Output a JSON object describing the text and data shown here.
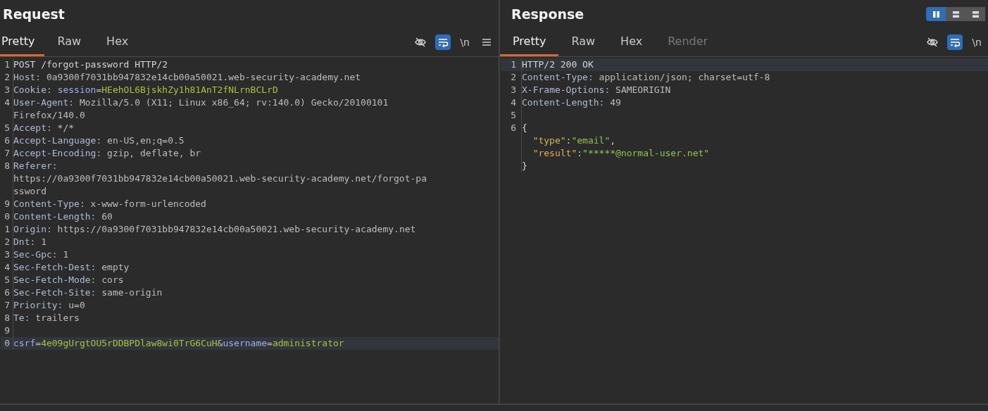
{
  "request": {
    "title": "Request",
    "tabs": [
      {
        "label": "Pretty",
        "selected": true,
        "disabled": false
      },
      {
        "label": "Raw",
        "selected": false,
        "disabled": false
      },
      {
        "label": "Hex",
        "selected": false,
        "disabled": false
      }
    ],
    "toolbar": {
      "hide_on": false,
      "wrap_on": true,
      "newline_label": "\\n",
      "menu": true
    },
    "lines": [
      {
        "number": "1",
        "highlighted": false,
        "tokens": [
          {
            "kind": "plain",
            "text": "POST /forgot-password HTTP/2"
          }
        ]
      },
      {
        "number": "2",
        "highlighted": false,
        "tokens": [
          {
            "kind": "name",
            "text": "Host:"
          },
          {
            "kind": "value",
            "text": " 0a9300f7031bb947832e14cb00a50021.web-security-academy.net"
          }
        ]
      },
      {
        "number": "3",
        "highlighted": false,
        "tokens": [
          {
            "kind": "name",
            "text": "Cookie: "
          },
          {
            "kind": "param",
            "text": "session"
          },
          {
            "kind": "value",
            "text": "="
          },
          {
            "kind": "paramvalue",
            "text": "HEehOL6BjskhZy1h81AnT2fNLrnBCLrD"
          }
        ]
      },
      {
        "number": "4",
        "highlighted": false,
        "tokens": [
          {
            "kind": "name",
            "text": "User-Agent:"
          },
          {
            "kind": "value",
            "text": " Mozilla/5.0 (X11; Linux x86_64; rv:140.0) Gecko/20100101"
          }
        ]
      },
      {
        "highlighted": false,
        "tokens": [
          {
            "kind": "value",
            "text": "Firefox/140.0"
          }
        ]
      },
      {
        "number": "5",
        "highlighted": false,
        "tokens": [
          {
            "kind": "name",
            "text": "Accept:"
          },
          {
            "kind": "value",
            "text": " */*"
          }
        ]
      },
      {
        "number": "6",
        "highlighted": false,
        "tokens": [
          {
            "kind": "name",
            "text": "Accept-Language:"
          },
          {
            "kind": "value",
            "text": " en-US,en;q=0.5"
          }
        ]
      },
      {
        "number": "7",
        "highlighted": false,
        "tokens": [
          {
            "kind": "name",
            "text": "Accept-Encoding:"
          },
          {
            "kind": "value",
            "text": " gzip, deflate, br"
          }
        ]
      },
      {
        "number": "8",
        "highlighted": false,
        "tokens": [
          {
            "kind": "name",
            "text": "Referer:"
          }
        ]
      },
      {
        "highlighted": false,
        "tokens": [
          {
            "kind": "value",
            "text": "https://0a9300f7031bb947832e14cb00a50021.web-security-academy.net/forgot-pa"
          }
        ]
      },
      {
        "highlighted": false,
        "tokens": [
          {
            "kind": "value",
            "text": "ssword"
          }
        ]
      },
      {
        "number": "9",
        "highlighted": false,
        "tokens": [
          {
            "kind": "name",
            "text": "Content-Type:"
          },
          {
            "kind": "value",
            "text": " x-www-form-urlencoded"
          }
        ]
      },
      {
        "number": "0",
        "highlighted": false,
        "tokens": [
          {
            "kind": "name",
            "text": "Content-Length:"
          },
          {
            "kind": "value",
            "text": " 60"
          }
        ]
      },
      {
        "number": "1",
        "highlighted": false,
        "tokens": [
          {
            "kind": "name",
            "text": "Origin:"
          },
          {
            "kind": "value",
            "text": " https://0a9300f7031bb947832e14cb00a50021.web-security-academy.net"
          }
        ]
      },
      {
        "number": "2",
        "highlighted": false,
        "tokens": [
          {
            "kind": "name",
            "text": "Dnt:"
          },
          {
            "kind": "value",
            "text": " 1"
          }
        ]
      },
      {
        "number": "3",
        "highlighted": false,
        "tokens": [
          {
            "kind": "name",
            "text": "Sec-Gpc:"
          },
          {
            "kind": "value",
            "text": " 1"
          }
        ]
      },
      {
        "number": "4",
        "highlighted": false,
        "tokens": [
          {
            "kind": "name",
            "text": "Sec-Fetch-Dest:"
          },
          {
            "kind": "value",
            "text": " empty"
          }
        ]
      },
      {
        "number": "5",
        "highlighted": false,
        "tokens": [
          {
            "kind": "name",
            "text": "Sec-Fetch-Mode:"
          },
          {
            "kind": "value",
            "text": " cors"
          }
        ]
      },
      {
        "number": "6",
        "highlighted": false,
        "tokens": [
          {
            "kind": "name",
            "text": "Sec-Fetch-Site:"
          },
          {
            "kind": "value",
            "text": " same-origin"
          }
        ]
      },
      {
        "number": "7",
        "highlighted": false,
        "tokens": [
          {
            "kind": "name",
            "text": "Priority:"
          },
          {
            "kind": "value",
            "text": " u=0"
          }
        ]
      },
      {
        "number": "8",
        "highlighted": false,
        "tokens": [
          {
            "kind": "name",
            "text": "Te:"
          },
          {
            "kind": "value",
            "text": " trailers"
          }
        ]
      },
      {
        "number": "9",
        "highlighted": false
      },
      {
        "number": "0",
        "highlighted": true,
        "tokens": [
          {
            "kind": "param",
            "text": "csrf"
          },
          {
            "kind": "value",
            "text": "="
          },
          {
            "kind": "paramvalue",
            "text": "4e09gUrgtOU5rDDBPDlaw8wi0TrG6CuH"
          },
          {
            "kind": "value",
            "text": "&"
          },
          {
            "kind": "param",
            "text": "username"
          },
          {
            "kind": "value",
            "text": "="
          },
          {
            "kind": "paramvalue",
            "text": "administrator"
          }
        ]
      }
    ]
  },
  "response": {
    "title": "Response",
    "layout_toggle": [
      {
        "selected": true
      },
      {
        "selected": false
      },
      {
        "selected": false
      }
    ],
    "tabs": [
      {
        "label": "Pretty",
        "selected": true,
        "disabled": false
      },
      {
        "label": "Raw",
        "selected": false,
        "disabled": false
      },
      {
        "label": "Hex",
        "selected": false,
        "disabled": false
      },
      {
        "label": "Render",
        "selected": false,
        "disabled": true
      }
    ],
    "toolbar": {
      "hide_on": false,
      "wrap_on": true,
      "newline_label": "\\n"
    },
    "lines": [
      {
        "number": "1",
        "highlighted": true,
        "tokens": [
          {
            "kind": "plain",
            "text": "HTTP/2 200 OK"
          }
        ]
      },
      {
        "number": "2",
        "highlighted": false,
        "tokens": [
          {
            "kind": "name",
            "text": "Content-Type:"
          },
          {
            "kind": "value",
            "text": " application/json; charset=utf-8"
          }
        ]
      },
      {
        "number": "3",
        "highlighted": false,
        "tokens": [
          {
            "kind": "name",
            "text": "X-Frame-Options:"
          },
          {
            "kind": "value",
            "text": " SAMEORIGIN"
          }
        ]
      },
      {
        "number": "4",
        "highlighted": false,
        "tokens": [
          {
            "kind": "name",
            "text": "Content-Length:"
          },
          {
            "kind": "value",
            "text": " 49"
          }
        ]
      },
      {
        "number": "5",
        "highlighted": false
      },
      {
        "number": "6",
        "highlighted": false,
        "tokens": [
          {
            "kind": "plain",
            "text": "{"
          }
        ]
      },
      {
        "indented": true,
        "highlighted": false,
        "tokens": [
          {
            "kind": "key",
            "text": "\"type\""
          },
          {
            "kind": "plain",
            "text": ":"
          },
          {
            "kind": "string",
            "text": "\"email\""
          },
          {
            "kind": "plain",
            "text": ","
          }
        ]
      },
      {
        "indented": true,
        "highlighted": false,
        "tokens": [
          {
            "kind": "key",
            "text": "\"result\""
          },
          {
            "kind": "plain",
            "text": ":"
          },
          {
            "kind": "string",
            "text": "\"*****@normal-user.net\""
          }
        ]
      },
      {
        "highlighted": false,
        "tokens": [
          {
            "kind": "plain",
            "text": "}"
          }
        ]
      }
    ]
  }
}
